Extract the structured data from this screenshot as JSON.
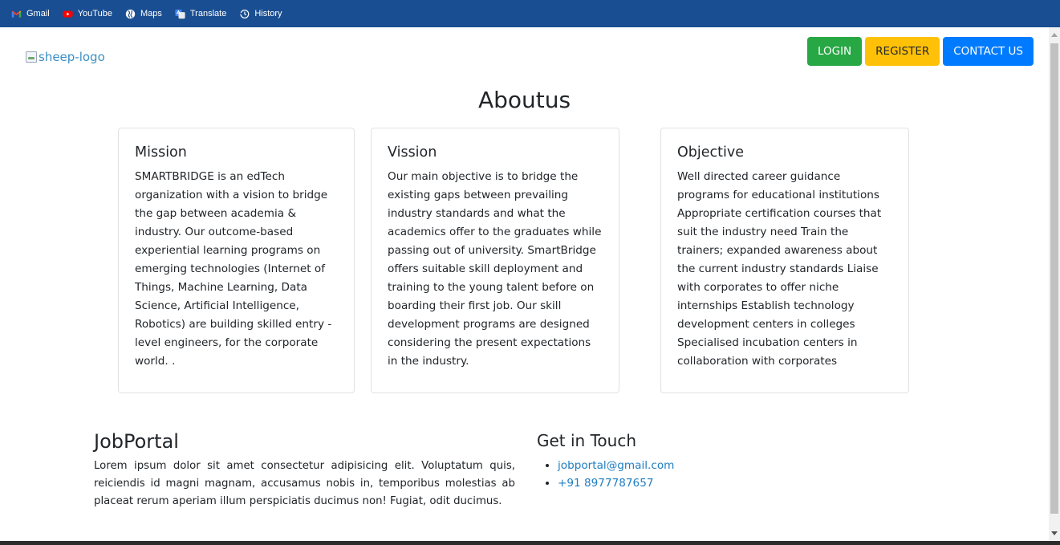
{
  "bookmarks": [
    {
      "label": "Gmail",
      "icon": "gmail-icon"
    },
    {
      "label": "YouTube",
      "icon": "youtube-icon"
    },
    {
      "label": "Maps",
      "icon": "maps-icon"
    },
    {
      "label": "Translate",
      "icon": "translate-icon"
    },
    {
      "label": "History",
      "icon": "history-icon"
    }
  ],
  "header": {
    "logo_alt": "sheep-logo",
    "login_label": "LOGIN",
    "register_label": "REGISTER",
    "contact_label": "CONTACT US"
  },
  "about": {
    "title": "Aboutus",
    "cards": [
      {
        "title": "Mission",
        "text": "SMARTBRIDGE is an edTech organization with a vision to bridge the gap between academia & industry. Our outcome-based experiential learning programs on emerging technologies (Internet of Things, Machine Learning, Data Science, Artificial Intelligence, Robotics) are building skilled entry -level engineers, for the corporate world. ."
      },
      {
        "title": "Vission",
        "text": "Our main objective is to bridge the existing gaps between prevailing industry standards and what the academics offer to the graduates while passing out of university. SmartBridge offers suitable skill deployment and training to the young talent before on boarding their first job. Our skill development programs are designed considering the present expectations in the industry."
      },
      {
        "title": "Objective",
        "text": "Well directed career guidance programs for educational institutions Appropriate certification courses that suit the industry need Train the trainers; expanded awareness about the current industry standards Liaise with corporates to offer niche internships Establish technology development centers in colleges Specialised incubation centers in collaboration with corporates"
      }
    ]
  },
  "footer": {
    "brand_title": "JobPortal",
    "brand_text": "Lorem ipsum dolor sit amet consectetur adipisicing elit. Voluptatum quis, reiciendis id magni magnam, accusamus nobis in, temporibus molestias ab placeat rerum aperiam illum perspiciatis ducimus non! Fugiat, odit ducimus.",
    "touch_title": "Get in Touch",
    "email": "jobportal@gmail.com",
    "phone": "+91 8977787657"
  },
  "colors": {
    "bookmarks_bar": "#1a4e92",
    "login": "#28a745",
    "register": "#ffc107",
    "contact": "#007bff",
    "link": "#1f7ec2"
  }
}
